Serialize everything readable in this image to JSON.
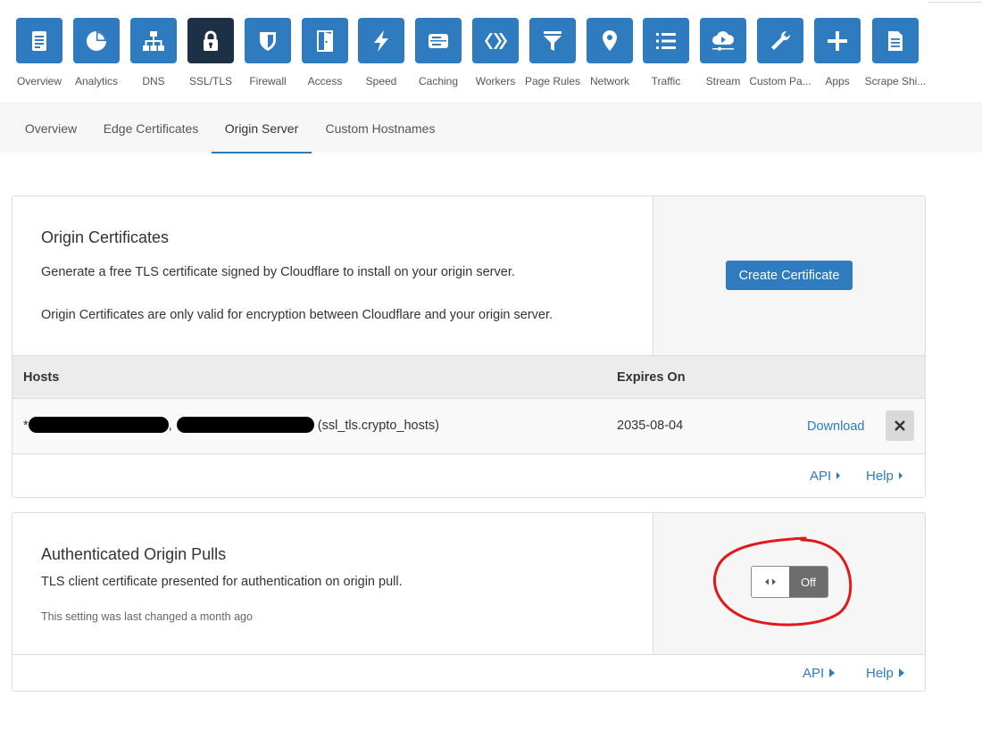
{
  "app_nav": [
    {
      "label": "Overview",
      "icon": "document-icon"
    },
    {
      "label": "Analytics",
      "icon": "pie-chart-icon"
    },
    {
      "label": "DNS",
      "icon": "network-tree-icon"
    },
    {
      "label": "SSL/TLS",
      "icon": "lock-icon",
      "active": true
    },
    {
      "label": "Firewall",
      "icon": "shield-icon"
    },
    {
      "label": "Access",
      "icon": "door-icon"
    },
    {
      "label": "Speed",
      "icon": "lightning-icon"
    },
    {
      "label": "Caching",
      "icon": "server-icon"
    },
    {
      "label": "Workers",
      "icon": "workers-chevrons-icon"
    },
    {
      "label": "Page Rules",
      "icon": "filter-icon"
    },
    {
      "label": "Network",
      "icon": "location-pin-icon"
    },
    {
      "label": "Traffic",
      "icon": "list-icon"
    },
    {
      "label": "Stream",
      "icon": "cloud-play-icon"
    },
    {
      "label": "Custom Pa...",
      "icon": "wrench-icon"
    },
    {
      "label": "Apps",
      "icon": "plus-icon"
    },
    {
      "label": "Scrape Shi...",
      "icon": "document-lines-icon"
    }
  ],
  "sub_tabs": [
    {
      "label": "Overview"
    },
    {
      "label": "Edge Certificates"
    },
    {
      "label": "Origin Server",
      "active": true
    },
    {
      "label": "Custom Hostnames"
    }
  ],
  "origin_certificates": {
    "title": "Origin Certificates",
    "description": "Generate a free TLS certificate signed by Cloudflare to install on your origin server.",
    "note": "Origin Certificates are only valid for encryption between Cloudflare and your origin server.",
    "create_button": "Create Certificate",
    "table": {
      "headers": {
        "hosts": "Hosts",
        "expires": "Expires On"
      },
      "rows": [
        {
          "host_prefix": "*",
          "host_sep": ",",
          "host_suffix": "(ssl_tls.crypto_hosts)",
          "expires": "2035-08-04",
          "action": "Download"
        }
      ]
    },
    "footer": {
      "api": "API",
      "help": "Help"
    }
  },
  "authenticated_origin_pulls": {
    "title": "Authenticated Origin Pulls",
    "description": "TLS client certificate presented for authentication on origin pull.",
    "last_changed": "This setting was last changed a month ago",
    "toggle_state": "Off",
    "footer": {
      "api": "API",
      "help": "Help"
    }
  },
  "colors": {
    "accent": "#2f7bbf",
    "active_tile": "#1d3146",
    "toggle_off": "#6d6d6d",
    "annotation": "#e0191c"
  }
}
